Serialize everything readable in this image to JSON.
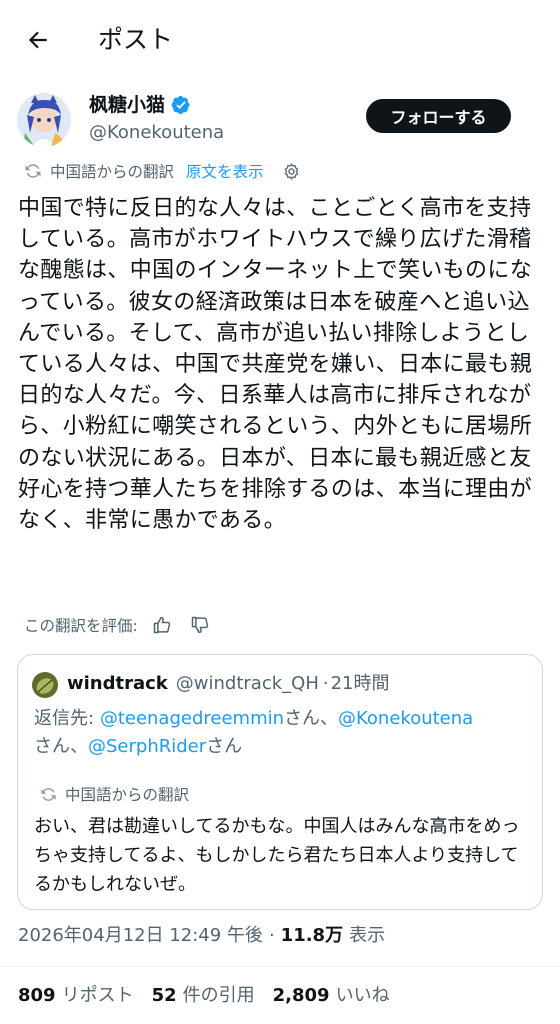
{
  "header": {
    "title": "ポスト"
  },
  "author": {
    "name": "枫糖小猫",
    "handle": "@Konekoutena",
    "follow_label": "フォローする"
  },
  "translation": {
    "label": "中国語からの翻訳",
    "show_original": "原文を表示"
  },
  "post": {
    "text": "中国で特に反日的な人々は、ことごとく高市を支持している。高市がホワイトハウスで繰り広げた滑稽な醜態は、中国のインターネット上で笑いものになっている。彼女の経済政策は日本を破産へと追い込んでいる。そして、高市が追い払い排除しようとしている人々は、中国で共産党を嫌い、日本に最も親日的な人々だ。今、日系華人は高市に排斥されながら、小粉紅に嘲笑されるという、内外ともに居場所のない状況にある。日本が、日本に最も親近感と友好心を持つ華人たちを排除するのは、本当に理由がなく、非常に愚かである。"
  },
  "rate_translation": {
    "label": "この翻訳を評価:"
  },
  "quote": {
    "name": "windtrack",
    "handle": "@windtrack_QH",
    "separator": "·",
    "time": "21時間",
    "reply_prefix": "返信先:",
    "mention1": "@teenagedreemmin",
    "mention2": "@Konekoutena",
    "mention3": "@SerphRider",
    "san": "さん",
    "sep": "、",
    "translation_label": "中国語からの翻訳",
    "text": "おい、君は勘違いしてるかもな。中国人はみんな高市をめっちゃ支持してるよ、もしかしたら君たち日本人より支持してるかもしれないぜ。"
  },
  "meta": {
    "timestamp": "2026年04月12日 12:49 午後",
    "dot": "·",
    "views": "11.8万",
    "views_label": "表示"
  },
  "stats": {
    "reposts": "809",
    "reposts_label": "リポスト",
    "quotes": "52",
    "quotes_label": "件の引用",
    "likes": "2,809",
    "likes_label": "いいね"
  },
  "colors": {
    "accent": "#1d9bf0",
    "text": "#0f1419",
    "muted": "#536471",
    "border": "#cfd9de",
    "button_bg": "#0f1419"
  },
  "icons": [
    "back-arrow-icon",
    "verified-badge-icon",
    "translate-icon",
    "gear-icon",
    "thumbs-up-icon",
    "thumbs-down-icon"
  ]
}
